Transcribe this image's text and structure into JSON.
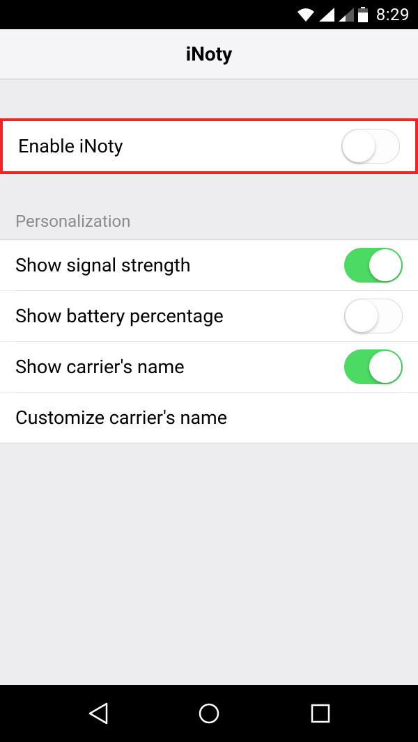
{
  "status": {
    "time": "8:29"
  },
  "header": {
    "title": "iNoty"
  },
  "enable": {
    "label": "Enable iNoty",
    "on": false
  },
  "section": {
    "title": "Personalization"
  },
  "rows": [
    {
      "label": "Show signal strength",
      "on": true
    },
    {
      "label": "Show battery percentage",
      "on": false
    },
    {
      "label": "Show carrier's name",
      "on": true
    },
    {
      "label": "Customize carrier's name"
    }
  ]
}
